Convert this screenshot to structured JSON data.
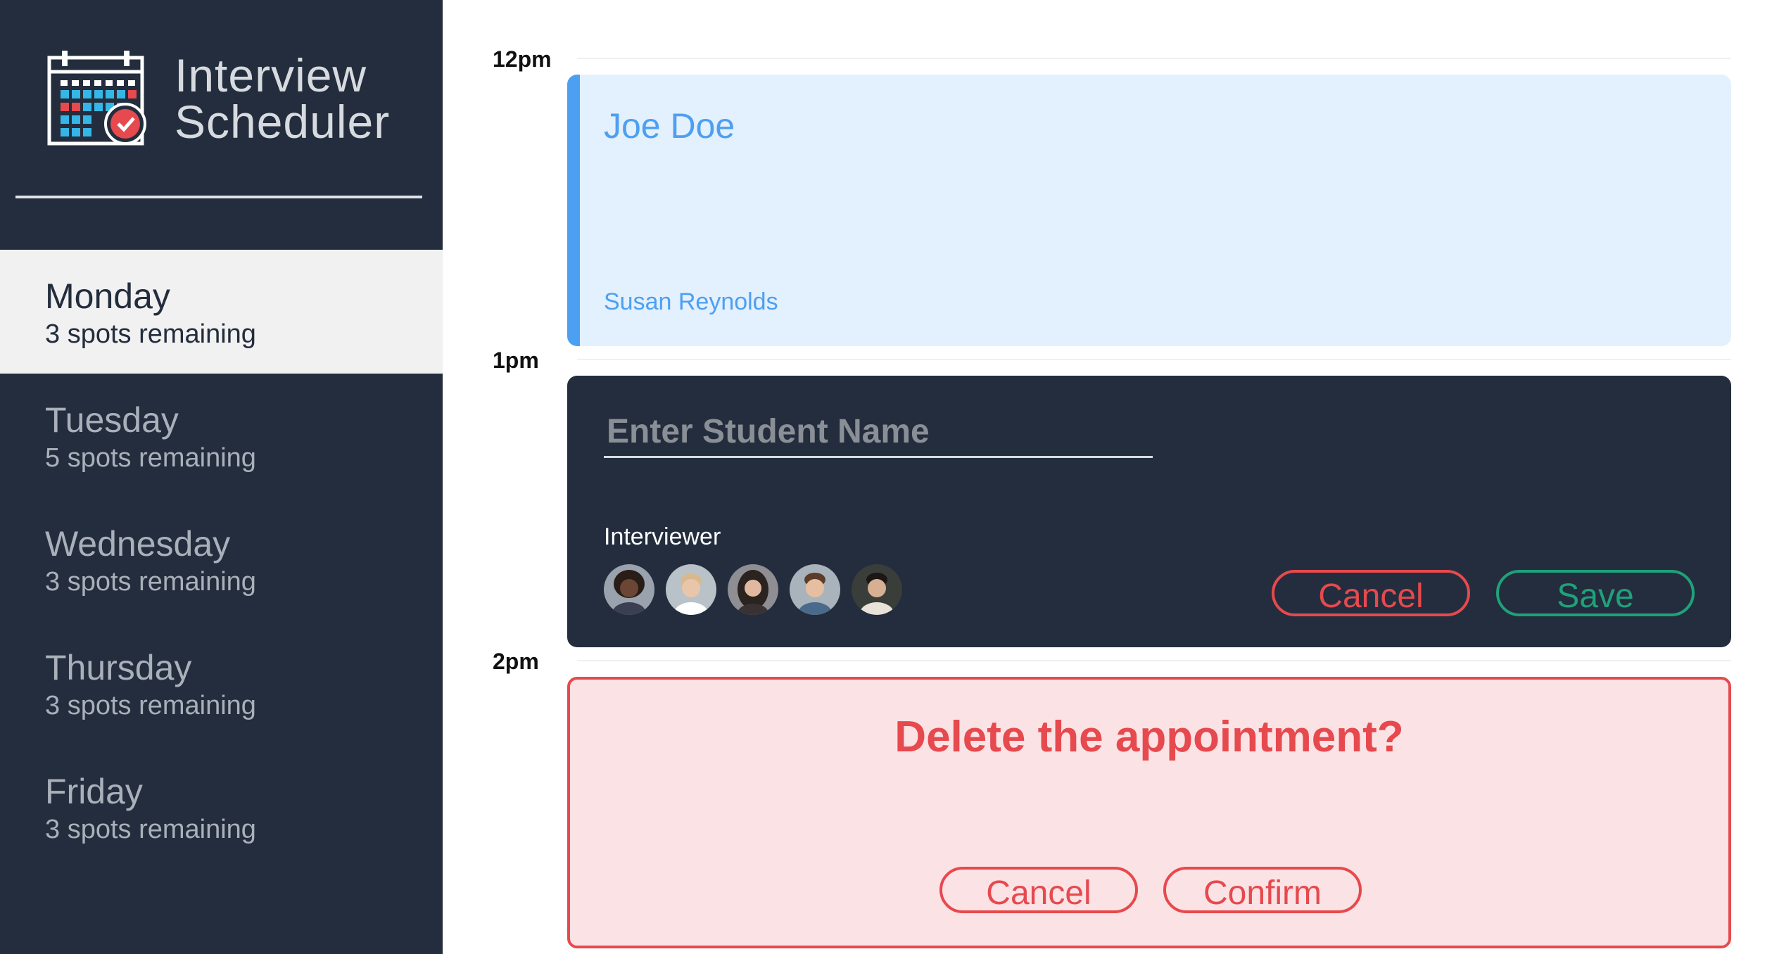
{
  "brand": {
    "line1": "Interview",
    "line2": "Scheduler",
    "logo_icon": "calendar-check-icon"
  },
  "days": [
    {
      "name": "Monday",
      "spots": "3 spots remaining",
      "selected": true
    },
    {
      "name": "Tuesday",
      "spots": "5 spots remaining",
      "selected": false
    },
    {
      "name": "Wednesday",
      "spots": "3 spots remaining",
      "selected": false
    },
    {
      "name": "Thursday",
      "spots": "3 spots remaining",
      "selected": false
    },
    {
      "name": "Friday",
      "spots": "3 spots remaining",
      "selected": false
    }
  ],
  "times": [
    "12pm",
    "1pm",
    "2pm"
  ],
  "appointments": {
    "booked": {
      "student": "Joe Doe",
      "interviewer": "Susan Reynolds"
    },
    "form": {
      "placeholder": "Enter Student Name",
      "interviewer_label": "Interviewer",
      "cancel_label": "Cancel",
      "save_label": "Save"
    },
    "confirm": {
      "message": "Delete the appointment?",
      "cancel_label": "Cancel",
      "confirm_label": "Confirm"
    }
  },
  "colors": {
    "sidebar": "#232d3d",
    "selected_day": "#f1f1f1",
    "booked_bg": "#e3f0fd",
    "accent_blue": "#4d9ff2",
    "danger": "#e6494e",
    "success": "#1fa17a",
    "confirm_bg": "#fbe2e4"
  }
}
